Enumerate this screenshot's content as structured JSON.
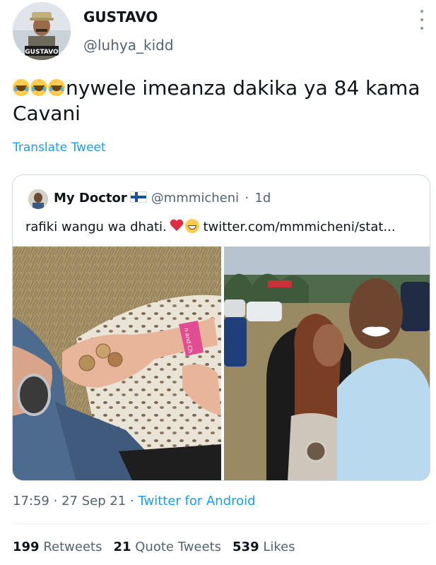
{
  "author": {
    "name": "GUSTAVO",
    "handle": "@luhya_kidd",
    "avatar_caption": "GUSTAVO"
  },
  "tweet": {
    "emoji": [
      "face-with-tears-of-joy",
      "face-with-tears-of-joy",
      "face-with-tears-of-joy"
    ],
    "text_line1": "nywele imeanza dakika ya 84 kama",
    "text_line2": "Cavani",
    "translate_label": "Translate Tweet"
  },
  "quoted": {
    "name": "My Doctor",
    "flag_icon": "finland-flag",
    "handle": "@mmmicheni",
    "sep": "·",
    "age": "1d",
    "text": "rafiki wangu wa dhati.",
    "text_emoji": [
      "red-heart",
      "grinning-squinting-face"
    ],
    "link": "twitter.com/mmmicheni/stat...",
    "wristband_text": "n and Ch"
  },
  "meta": {
    "time": "17:59",
    "sep1": "·",
    "date": "27 Sep 21",
    "sep2": "·",
    "source": "Twitter for Android"
  },
  "stats": {
    "retweets_count": "199",
    "retweets_label": "Retweets",
    "quotes_count": "21",
    "quotes_label": "Quote Tweets",
    "likes_count": "539",
    "likes_label": "Likes"
  },
  "colors": {
    "link_blue": "#1d9bf0",
    "secondary_text": "#536471",
    "border": "#cfd9de"
  }
}
